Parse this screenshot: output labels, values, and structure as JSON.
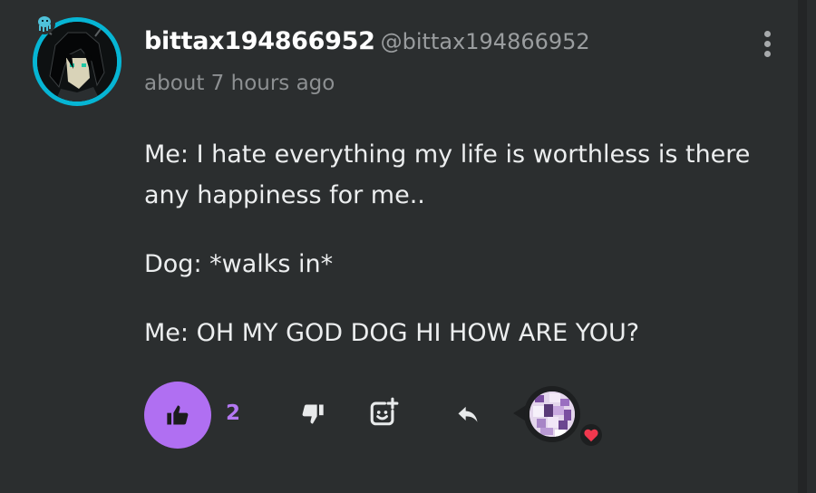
{
  "post": {
    "author": {
      "username": "bittax194866952",
      "handle": "@bittax194866952",
      "avatar_icon": "avatar-pixel-character",
      "badge_icon": "octopus-badge-icon",
      "avatar_ring_color": "#06b5d4"
    },
    "timestamp": "about 7 hours ago",
    "menu_icon": "more-vertical-icon",
    "body": {
      "line1": "Me: I hate everything my life is worthless is there any happiness for me..",
      "line2": "Dog: *walks in*",
      "line3": "Me: OH MY GOD DOG HI HOW ARE YOU?"
    },
    "actions": {
      "like_icon": "thumbs-up-icon",
      "like_count": "2",
      "like_color": "#b06ff2",
      "dislike_icon": "thumbs-down-icon",
      "react_icon": "add-reaction-icon",
      "reply_icon": "reply-icon",
      "reactor_icon": "reactor-avatar",
      "reaction_heart_icon": "heart-icon",
      "heart_color": "#f0384e"
    }
  }
}
